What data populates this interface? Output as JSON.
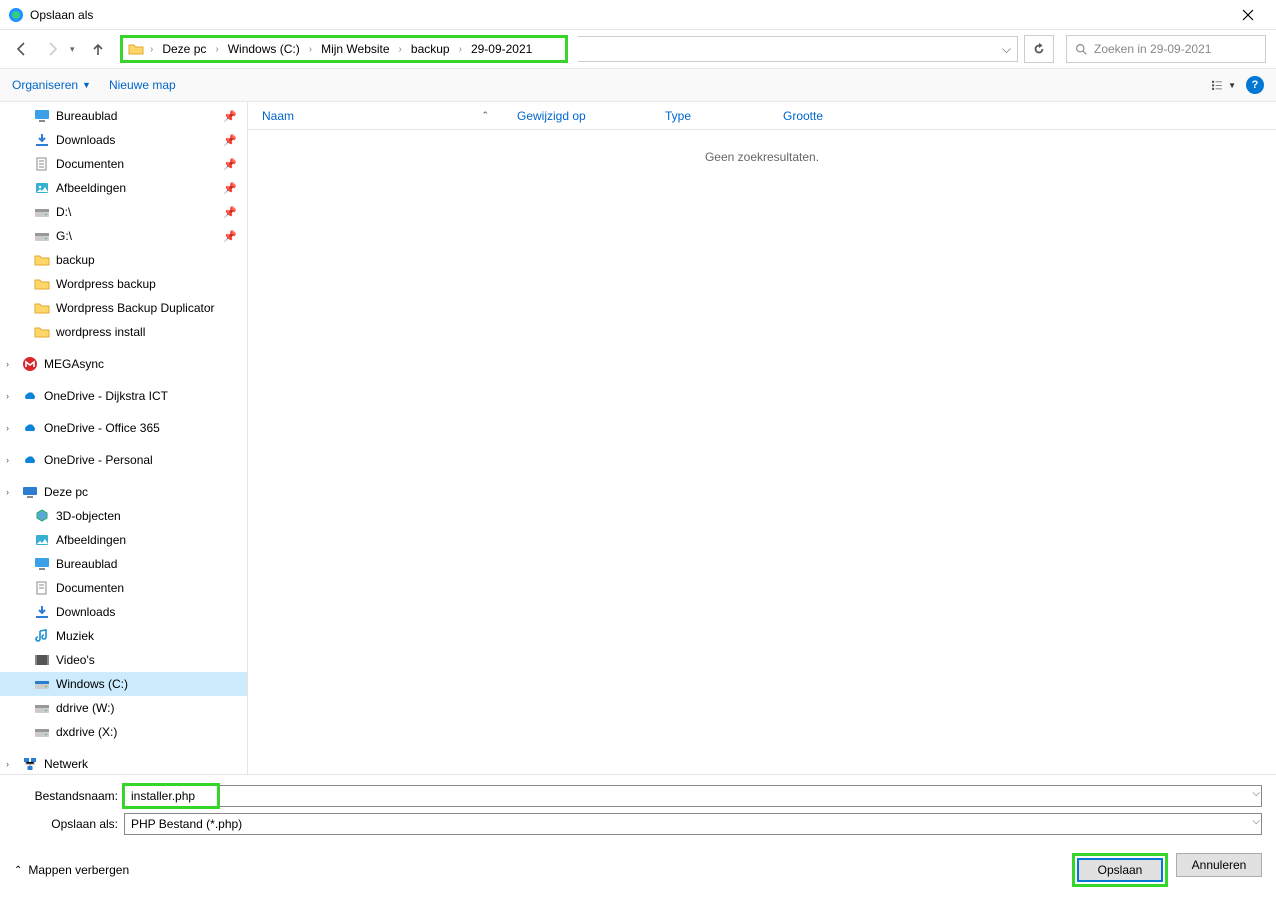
{
  "title": "Opslaan als",
  "nav": {
    "breadcrumb": [
      "Deze pc",
      "Windows (C:)",
      "Mijn Website",
      "backup",
      "29-09-2021"
    ],
    "search_placeholder": "Zoeken in 29-09-2021"
  },
  "toolbar": {
    "organize": "Organiseren",
    "new_folder": "Nieuwe map"
  },
  "sidebar": {
    "items": [
      {
        "label": "Bureaublad",
        "icon": "desktop-blue",
        "pin": true,
        "indent": true
      },
      {
        "label": "Downloads",
        "icon": "download",
        "pin": true,
        "indent": true
      },
      {
        "label": "Documenten",
        "icon": "documents",
        "pin": true,
        "indent": true
      },
      {
        "label": "Afbeeldingen",
        "icon": "pictures",
        "pin": true,
        "indent": true
      },
      {
        "label": "D:\\",
        "icon": "drive",
        "pin": true,
        "indent": true
      },
      {
        "label": "G:\\",
        "icon": "drive",
        "pin": true,
        "indent": true
      },
      {
        "label": "backup",
        "icon": "folder",
        "indent": true
      },
      {
        "label": "Wordpress backup",
        "icon": "folder",
        "indent": true
      },
      {
        "label": "Wordpress Backup Duplicator",
        "icon": "folder",
        "indent": true
      },
      {
        "label": "wordpress install",
        "icon": "folder",
        "indent": true
      },
      {
        "label": "MEGAsync",
        "icon": "mega",
        "expand": true
      },
      {
        "label": "OneDrive - Dijkstra ICT",
        "icon": "onedrive",
        "expand": true
      },
      {
        "label": "OneDrive - Office 365",
        "icon": "onedrive",
        "expand": true
      },
      {
        "label": "OneDrive - Personal",
        "icon": "onedrive",
        "expand": true
      },
      {
        "label": "Deze pc",
        "icon": "pc",
        "expand": true
      },
      {
        "label": "3D-objecten",
        "icon": "3d",
        "indent": true
      },
      {
        "label": "Afbeeldingen",
        "icon": "pictures-lib",
        "indent": true
      },
      {
        "label": "Bureaublad",
        "icon": "desktop-lib",
        "indent": true
      },
      {
        "label": "Documenten",
        "icon": "documents-lib",
        "indent": true
      },
      {
        "label": "Downloads",
        "icon": "download-lib",
        "indent": true
      },
      {
        "label": "Muziek",
        "icon": "music",
        "indent": true
      },
      {
        "label": "Video's",
        "icon": "video",
        "indent": true
      },
      {
        "label": "Windows (C:)",
        "icon": "drive-c",
        "indent": true,
        "selected": true
      },
      {
        "label": "ddrive (W:)",
        "icon": "drive",
        "indent": true
      },
      {
        "label": "dxdrive (X:)",
        "icon": "drive",
        "indent": true
      },
      {
        "label": "Netwerk",
        "icon": "network",
        "expand": true
      }
    ]
  },
  "columns": {
    "name": "Naam",
    "modified": "Gewijzigd op",
    "type": "Type",
    "size": "Grootte"
  },
  "content": {
    "empty": "Geen zoekresultaten."
  },
  "footer": {
    "filename_label": "Bestandsnaam:",
    "filename_value": "installer.php",
    "saveas_label": "Opslaan als:",
    "saveas_value": "PHP Bestand (*.php)",
    "hide_folders": "Mappen verbergen",
    "save": "Opslaan",
    "cancel": "Annuleren"
  }
}
